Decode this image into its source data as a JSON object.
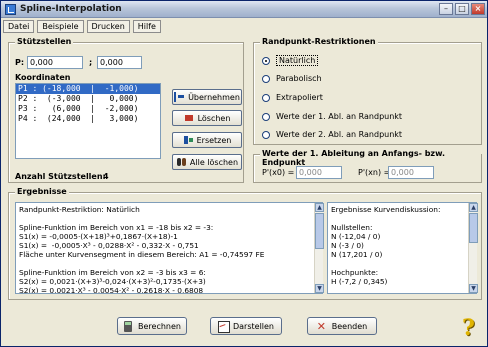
{
  "window": {
    "title": "Spline-Interpolation"
  },
  "menu": [
    "Datei",
    "Beispiele",
    "Drucken",
    "Hilfe"
  ],
  "stuetzstellen": {
    "group_title": "Stützstellen",
    "p_label": "P:",
    "p_x": "0,000",
    "p_sep": ";",
    "p_y": "0,000",
    "koordinaten_label": "Koordinaten",
    "points": [
      "P1 : (-18,000  |  -1,000)",
      "P2 :  (-3,000  |   0,000)",
      "P3 :   (6,000  |  -2,000)",
      "P4 :  (24,000  |   3,000)"
    ],
    "anzahl_label": "Anzahl Stützstellen:",
    "anzahl_value": "4",
    "buttons": {
      "uebernehmen": "Übernehmen",
      "loeschen": "Löschen",
      "ersetzen": "Ersetzen",
      "alle_loeschen": "Alle löschen"
    }
  },
  "randpunkt": {
    "group_title": "Randpunkt-Restriktionen",
    "options": [
      "Natürlich",
      "Parabolisch",
      "Extrapoliert",
      "Werte der 1. Abl. an Randpunkt",
      "Werte der 2. Abl. an Randpunkt"
    ],
    "selected_index": 0
  },
  "ableitung": {
    "group_title": "Werte der 1. Ableitung an Anfangs- bzw. Endpunkt",
    "p0_label": "P'(x0) =",
    "p0_value": "0,000",
    "pn_label": "P'(xn) =",
    "pn_value": "0,000"
  },
  "ergebnisse": {
    "group_title": "Ergebnisse",
    "left_text": "Randpunkt-Restriktion: Natürlich\n\nSpline-Funktion im Bereich von x1 = -18 bis x2 = -3:\nS1(x) = -0,0005·(X+18)³+0,1867·(X+18)-1\nS1(x) =  -0,0005·X³ - 0,0288·X² - 0,332·X - 0,751\nFläche unter Kurvensegment in diesem Bereich: A1 = -0,74597 FE\n\nSpline-Funktion im Bereich von x2 = -3 bis x3 = 6:\nS2(x) = 0,0021·(X+3)³-0,024·(X+3)²-0,1735·(X+3)\nS2(x) = 0,0021·X³ - 0,0054·X² - 0,2618·X - 0,6808",
    "right_text": "Ergebnisse Kurvendiskussion:\n\nNullstellen:\nN (-12,04 / 0)\nN (-3 / 0)\nN (17,201 / 0)\n\nHochpunkte:\nH (-7,2 / 0,345)"
  },
  "bottom_buttons": {
    "berechnen": "Berechnen",
    "darstellen": "Darstellen",
    "beenden": "Beenden"
  },
  "help_symbol": "?"
}
